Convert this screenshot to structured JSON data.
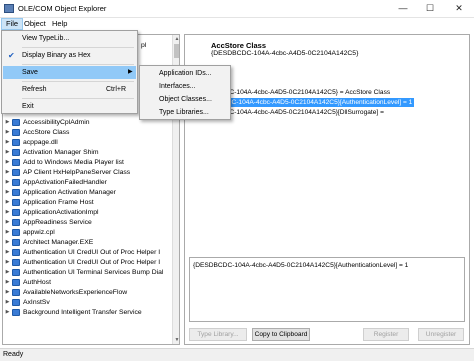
{
  "window": {
    "title": "OLE/COM Object Explorer",
    "minimize_glyph": "—",
    "maximize_glyph": "☐",
    "close_glyph": "✕"
  },
  "menubar": {
    "file": "File",
    "object": "Object",
    "help": "Help"
  },
  "file_menu": {
    "view_typelib": "View TypeLib...",
    "display_binary_hex": "Display Binary as Hex",
    "save": "Save",
    "refresh": "Refresh",
    "refresh_shortcut": "Ctrl+R",
    "exit": "Exit",
    "checkmark": "✔",
    "submenu_arrow": "▶"
  },
  "save_submenu": {
    "application_ids": "Application IDs...",
    "interfaces": "Interfaces...",
    "object_classes": "Object Classes...",
    "type_libraries": "Type Libraries..."
  },
  "tree": {
    "partial_top_item": "pl",
    "items": [
      "AccessibilityCplAdmin",
      "AccStore Class",
      "acppage.dll",
      "Activation Manager Shim",
      "Add to Windows Media Player list",
      "AP Client HxHelpPaneServer Class",
      "AppActivationFailedHandler",
      "Application Activation Manager",
      "Application Frame Host",
      "ApplicationActivationImpl",
      "AppReadiness Service",
      "appwiz.cpl",
      "Architect Manager.EXE",
      "Authentication UI CredUI Out of Proc Helper I",
      "Authentication UI CredUI Out of Proc Helper I",
      "Authentication UI Terminal Services Bump Dial",
      "AuthHost",
      "AvailableNetworksExperienceFlow",
      "AxInstSv",
      "Background Intelligent Transfer Service"
    ]
  },
  "detail": {
    "class_name": "AccStore Class",
    "class_guid": "{DESDBCDC-104A-4cbc-A4D5-0C2104A142C5}",
    "reg_lines": [
      "{DESDBCDC-104A-4cbc-A4D5-0C2104A142C5} = AccStore Class",
      "{DESDBCDC-104A-4cbc-A4D5-0C2104A142C5}[AuthenticationLevel] = 1",
      "{DESDBCDC-104A-4cbc-A4D5-0C2104A142C5}[DllSurrogate] ="
    ],
    "value_box": "{DESDBCDC-104A-4cbc-A4D5-0C2104A142C5}[AuthenticationLevel] = 1"
  },
  "buttons": {
    "type_library": "Type Library...",
    "copy_clipboard": "Copy to Clipboard",
    "register": "Register",
    "unregister": "Unregister"
  },
  "status": {
    "text": "Ready"
  },
  "colors": {
    "selection": "#3399ff",
    "menu_hover": "#91c9f7",
    "tree_icon": "#3a7bd5"
  }
}
